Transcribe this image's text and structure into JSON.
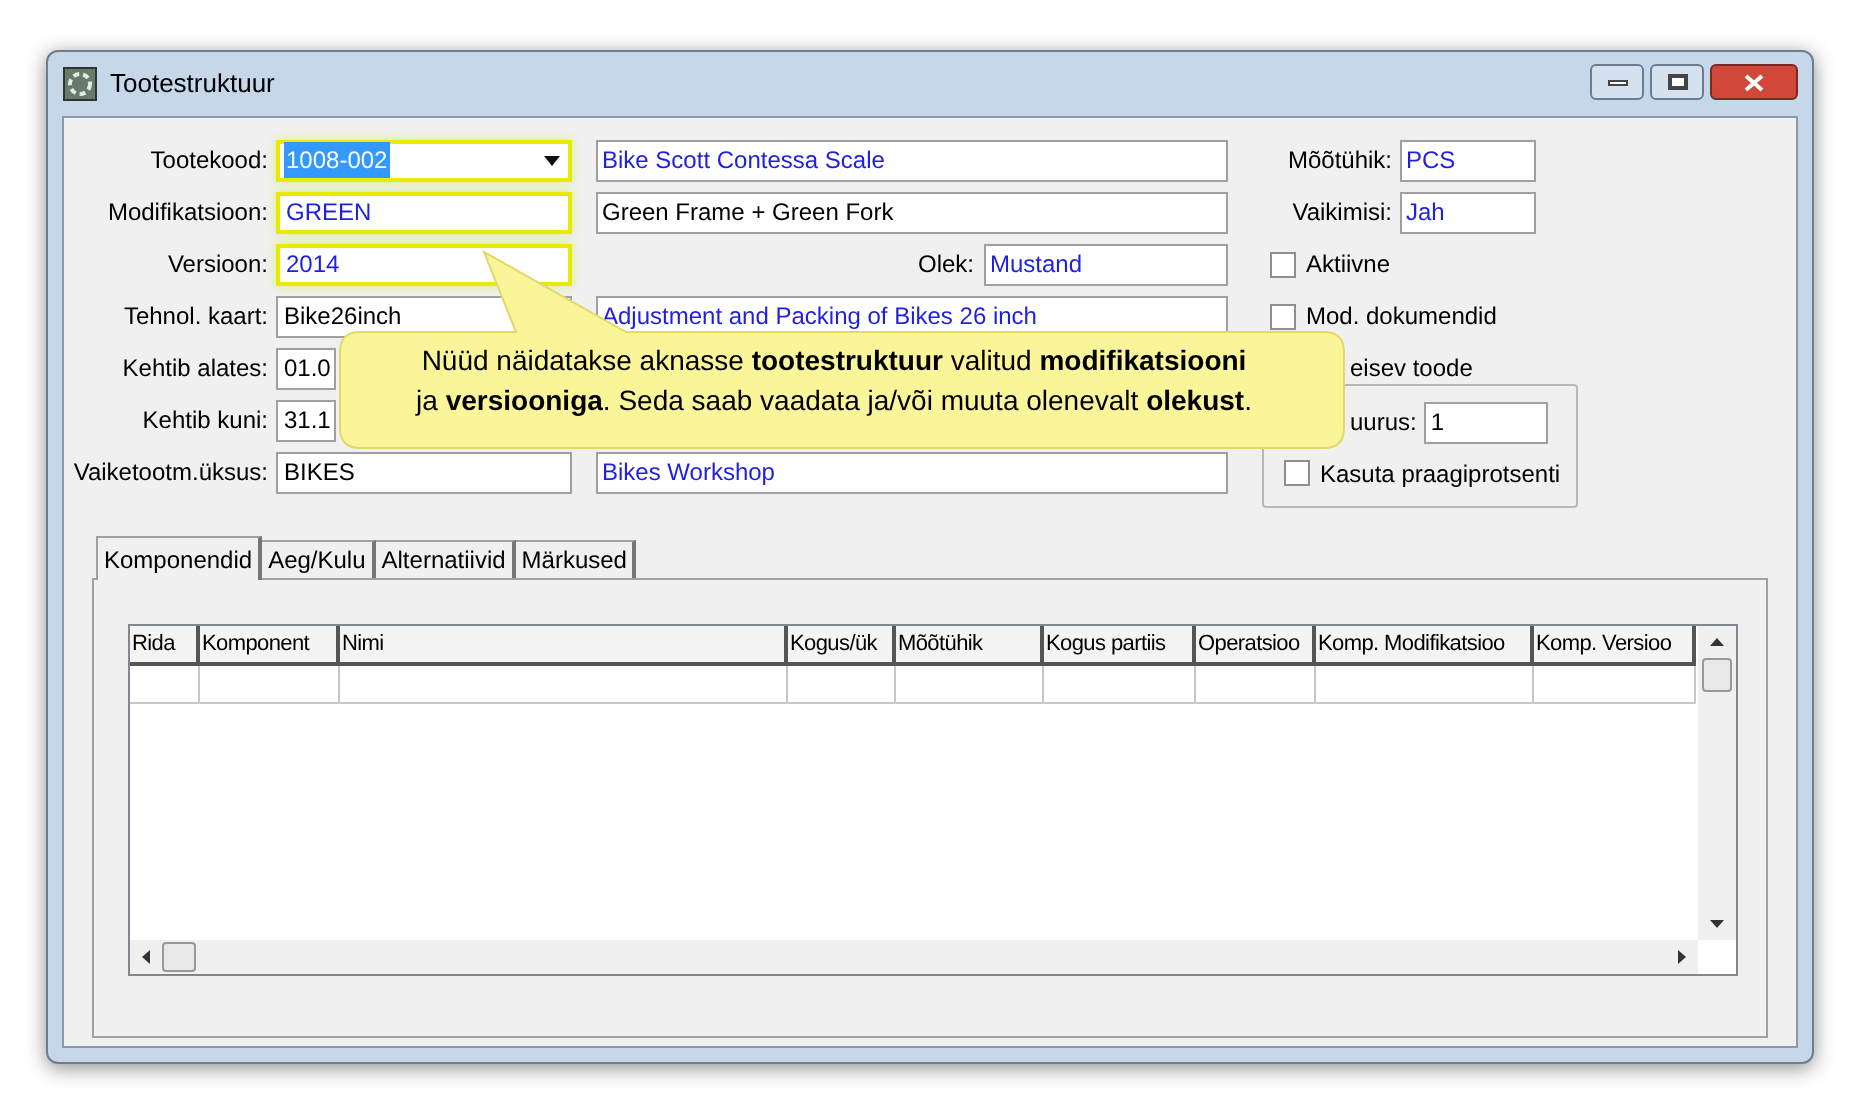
{
  "window": {
    "title": "Tootestruktuur"
  },
  "form": {
    "rows": [
      {
        "label": "Tootekood:",
        "value": "1008-002",
        "kind": "combo",
        "highlighted": true,
        "value_selected": true,
        "description": {
          "text": "Bike Scott Contessa Scale",
          "lookup": true
        }
      },
      {
        "label": "Modifikatsioon:",
        "value": "GREEN",
        "kind": "text",
        "highlighted": true,
        "value_selected": false,
        "lookup": true,
        "description": {
          "text": "Green Frame + Green Fork",
          "lookup": false
        }
      },
      {
        "label": "Versioon:",
        "value": "2014",
        "kind": "text",
        "highlighted": true,
        "value_selected": false,
        "lookup": true,
        "status": {
          "label": "Olek:",
          "value": "Mustand",
          "lookup": true
        }
      },
      {
        "label": "Tehnol. kaart:",
        "value": "Bike26inch",
        "kind": "text",
        "highlighted": false,
        "value_selected": false,
        "lookup": false,
        "description": {
          "text": "Adjustment and Packing of Bikes 26 inch",
          "lookup": true
        }
      },
      {
        "label": "Kehtib alates:",
        "value": "01.0",
        "kind": "text",
        "highlighted": false,
        "value_selected": false,
        "lookup": false
      },
      {
        "label": "Kehtib kuni:",
        "value": "31.1",
        "kind": "text",
        "highlighted": false,
        "value_selected": false,
        "lookup": false
      },
      {
        "label": "Vaiketootm.üksus:",
        "value": "BIKES",
        "kind": "text",
        "highlighted": false,
        "value_selected": false,
        "lookup": false,
        "description": {
          "text": "Bikes Workshop",
          "lookup": true
        }
      }
    ],
    "side": [
      {
        "kind": "field",
        "label": "Mõõtühik:",
        "value": "PCS"
      },
      {
        "kind": "field",
        "label": "Vaikimisi:",
        "value": "Jah"
      },
      {
        "kind": "checkbox",
        "label": "Aktiivne",
        "checked": false
      },
      {
        "kind": "checkbox",
        "label": "Mod. dokumendid",
        "checked": false
      },
      {
        "kind": "partial",
        "label": "eisev toode"
      }
    ],
    "group": {
      "field_label": "uurus:",
      "field_value": "1",
      "checkbox": {
        "label": "Kasuta praagiprotsenti",
        "checked": false
      }
    }
  },
  "tabs": [
    {
      "label": "Komponendid",
      "selected": true
    },
    {
      "label": "Aeg/Kulu",
      "selected": false
    },
    {
      "label": "Alternatiivid",
      "selected": false
    },
    {
      "label": "Märkused",
      "selected": false
    }
  ],
  "table": {
    "columns": [
      "Rida",
      "Komponent",
      "Nimi",
      "Kogus/ük",
      "Mõõtühik",
      "Kogus partiis",
      "Operatsioo",
      "Komp. Modifikatsioo",
      "Komp. Versioo"
    ]
  },
  "callout": {
    "text": "Nüüd näidatakse aknasse **tootestruktuur** valitud **modifikatsiooni**\nja **versiooniga**. Seda saab vaadata ja/või muuta olenevalt **olekust**."
  }
}
